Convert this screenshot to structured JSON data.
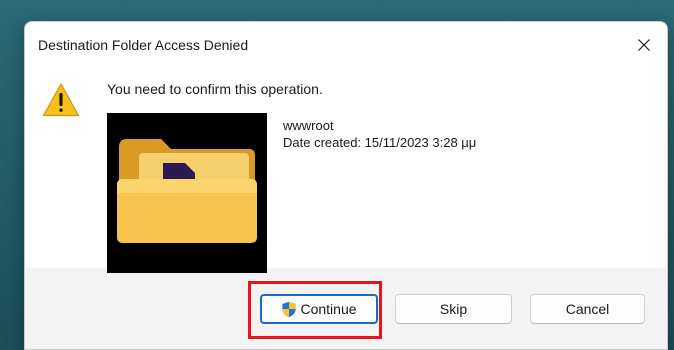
{
  "dialog": {
    "title": "Destination Folder Access Denied",
    "message": "You need to confirm this operation.",
    "file": {
      "name": "wwwroot",
      "date_created": "Date created: 15/11/2023 3:28 μμ"
    },
    "buttons": {
      "continue": "Continue",
      "skip": "Skip",
      "cancel": "Cancel"
    }
  },
  "icons": {
    "close": "close-icon",
    "warning": "warning-icon",
    "folder": "folder-icon",
    "shield": "uac-shield-icon"
  },
  "colors": {
    "highlight": "#e8141b",
    "accent": "#1b6ac9",
    "warning": "#f4c21b"
  }
}
